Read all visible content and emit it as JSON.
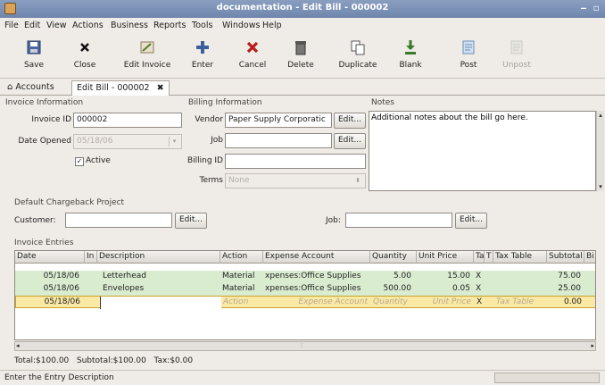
{
  "window": {
    "title": "documentation - Edit Bill - 000002"
  },
  "menu": [
    "File",
    "Edit",
    "View",
    "Actions",
    "Business",
    "Reports",
    "Tools",
    "Windows",
    "Help"
  ],
  "toolbar": {
    "save": "Save",
    "close": "Close",
    "edit_invoice": "Edit Invoice",
    "enter": "Enter",
    "cancel": "Cancel",
    "delete": "Delete",
    "duplicate": "Duplicate",
    "blank": "Blank",
    "post": "Post",
    "unpost": "Unpost"
  },
  "tabs": {
    "accounts": "Accounts",
    "edit_bill": "Edit Bill - 000002"
  },
  "invoice_info": {
    "section": "Invoice Information",
    "invoice_id_label": "Invoice ID",
    "invoice_id": "000002",
    "date_opened_label": "Date Opened",
    "date_opened": "05/18/06",
    "active_label": "Active",
    "active": true
  },
  "billing_info": {
    "section": "Billing Information",
    "vendor_label": "Vendor",
    "vendor": "Paper Supply Corporatic",
    "job_label": "Job",
    "job": "",
    "billing_id_label": "Billing ID",
    "billing_id": "",
    "terms_label": "Terms",
    "terms": "None",
    "edit": "Edit..."
  },
  "notes": {
    "section": "Notes",
    "text": "Additional notes about the bill go here."
  },
  "chargeback": {
    "section": "Default Chargeback Project",
    "customer_label": "Customer:",
    "customer": "",
    "job_label": "Job:",
    "job": "",
    "edit": "Edit..."
  },
  "entries": {
    "section": "Invoice Entries",
    "columns": [
      "Date",
      "In",
      "Description",
      "Action",
      "Expense Account",
      "Quantity",
      "Unit Price",
      "Ta",
      "T",
      "Tax Table",
      "Subtotal",
      "Bi"
    ],
    "rows": [
      {
        "date": "05/18/06",
        "description": "Letterhead",
        "action": "Material",
        "account": "xpenses:Office Supplies",
        "quantity": "5.00",
        "unit_price": "15.00",
        "taxable": "X",
        "subtotal": "75.00"
      },
      {
        "date": "05/18/06",
        "description": "Envelopes",
        "action": "Material",
        "account": "xpenses:Office Supplies",
        "quantity": "500.00",
        "unit_price": "0.05",
        "taxable": "X",
        "subtotal": "25.00"
      }
    ],
    "blank_row": {
      "date": "05/18/06",
      "action": "Action",
      "account": "Expense Account",
      "quantity": "Quantity",
      "unit_price": "Unit Price",
      "taxable": "X",
      "tax_table": "Tax Table",
      "subtotal": "0.00"
    }
  },
  "totals": {
    "total": "Total:$100.00",
    "subtotal": "Subtotal:$100.00",
    "tax": "Tax:$0.00"
  },
  "status": {
    "text": "Enter the Entry Description"
  },
  "colors": {
    "row_green": "#d9ecd0",
    "row_cursor": "#fae9a5",
    "title_bar": "#7b90b6"
  }
}
